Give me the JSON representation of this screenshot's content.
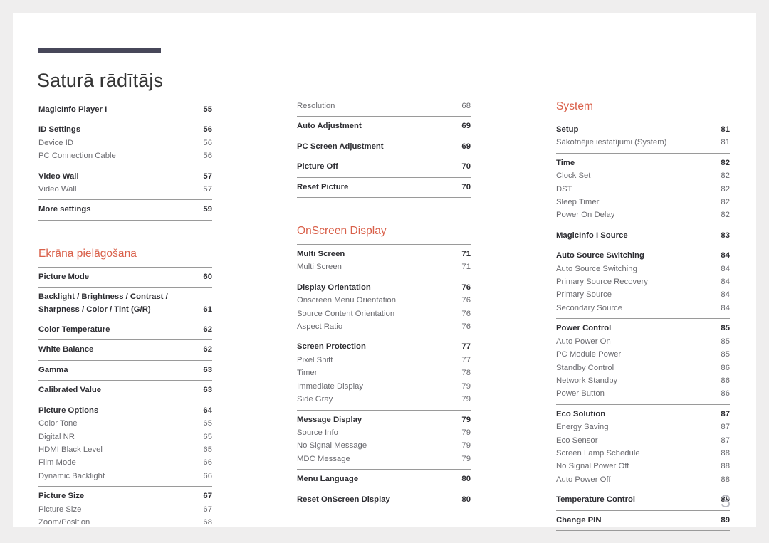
{
  "document": {
    "title": "Saturā rādītājs",
    "page_number": "3",
    "accent_color": "#d9604a",
    "rule_color": "#474759",
    "main_text_color": "#2e2e33",
    "sub_text_color": "#6a6a6f"
  },
  "columns": [
    {
      "id": "column-1",
      "blocks": [
        {
          "type": "groups",
          "groups": [
            {
              "entries": [
                {
                  "label": "MagicInfo Player I",
                  "page": "55",
                  "level": "main"
                }
              ]
            },
            {
              "entries": [
                {
                  "label": "ID Settings",
                  "page": "56",
                  "level": "main"
                },
                {
                  "label": "Device ID",
                  "page": "56",
                  "level": "sub"
                },
                {
                  "label": "PC Connection Cable",
                  "page": "56",
                  "level": "sub"
                }
              ]
            },
            {
              "entries": [
                {
                  "label": "Video Wall",
                  "page": "57",
                  "level": "main"
                },
                {
                  "label": "Video Wall",
                  "page": "57",
                  "level": "sub"
                }
              ]
            },
            {
              "last": true,
              "entries": [
                {
                  "label": "More settings",
                  "page": "59",
                  "level": "main"
                }
              ]
            }
          ]
        },
        {
          "type": "heading",
          "text": "Ekrāna pielāgošana",
          "gap": "large"
        },
        {
          "type": "groups",
          "groups": [
            {
              "entries": [
                {
                  "label": "Picture Mode",
                  "page": "60",
                  "level": "main"
                }
              ]
            },
            {
              "entries": [
                {
                  "label": "Backlight / Brightness / Contrast /\nSharpness / Color / Tint (G/R)",
                  "page": "61",
                  "level": "main",
                  "multiline": true
                }
              ]
            },
            {
              "entries": [
                {
                  "label": "Color Temperature",
                  "page": "62",
                  "level": "main"
                }
              ]
            },
            {
              "entries": [
                {
                  "label": "White Balance",
                  "page": "62",
                  "level": "main"
                }
              ]
            },
            {
              "entries": [
                {
                  "label": "Gamma",
                  "page": "63",
                  "level": "main"
                }
              ]
            },
            {
              "entries": [
                {
                  "label": "Calibrated Value",
                  "page": "63",
                  "level": "main"
                }
              ]
            },
            {
              "entries": [
                {
                  "label": "Picture Options",
                  "page": "64",
                  "level": "main"
                },
                {
                  "label": "Color Tone",
                  "page": "65",
                  "level": "sub"
                },
                {
                  "label": "Digital NR",
                  "page": "65",
                  "level": "sub"
                },
                {
                  "label": "HDMI Black Level",
                  "page": "65",
                  "level": "sub"
                },
                {
                  "label": "Film Mode",
                  "page": "66",
                  "level": "sub"
                },
                {
                  "label": "Dynamic Backlight",
                  "page": "66",
                  "level": "sub"
                }
              ]
            },
            {
              "entries": [
                {
                  "label": "Picture Size",
                  "page": "67",
                  "level": "main"
                },
                {
                  "label": "Picture Size",
                  "page": "67",
                  "level": "sub"
                },
                {
                  "label": "Zoom/Position",
                  "page": "68",
                  "level": "sub"
                }
              ]
            }
          ]
        }
      ]
    },
    {
      "id": "column-2",
      "blocks": [
        {
          "type": "groups",
          "groups": [
            {
              "entries": [
                {
                  "label": "Resolution",
                  "page": "68",
                  "level": "sub"
                }
              ]
            },
            {
              "entries": [
                {
                  "label": "Auto Adjustment",
                  "page": "69",
                  "level": "main"
                }
              ]
            },
            {
              "entries": [
                {
                  "label": "PC Screen Adjustment",
                  "page": "69",
                  "level": "main"
                }
              ]
            },
            {
              "entries": [
                {
                  "label": "Picture Off",
                  "page": "70",
                  "level": "main"
                }
              ]
            },
            {
              "last": true,
              "entries": [
                {
                  "label": "Reset Picture",
                  "page": "70",
                  "level": "main"
                }
              ]
            }
          ]
        },
        {
          "type": "heading",
          "text": "OnScreen Display",
          "gap": "large"
        },
        {
          "type": "groups",
          "groups": [
            {
              "entries": [
                {
                  "label": "Multi Screen",
                  "page": "71",
                  "level": "main"
                },
                {
                  "label": "Multi Screen",
                  "page": "71",
                  "level": "sub"
                }
              ]
            },
            {
              "entries": [
                {
                  "label": "Display Orientation",
                  "page": "76",
                  "level": "main"
                },
                {
                  "label": "Onscreen Menu Orientation",
                  "page": "76",
                  "level": "sub"
                },
                {
                  "label": "Source Content Orientation",
                  "page": "76",
                  "level": "sub"
                },
                {
                  "label": "Aspect Ratio",
                  "page": "76",
                  "level": "sub"
                }
              ]
            },
            {
              "entries": [
                {
                  "label": "Screen Protection",
                  "page": "77",
                  "level": "main"
                },
                {
                  "label": "Pixel Shift",
                  "page": "77",
                  "level": "sub"
                },
                {
                  "label": "Timer",
                  "page": "78",
                  "level": "sub"
                },
                {
                  "label": "Immediate Display",
                  "page": "79",
                  "level": "sub"
                },
                {
                  "label": "Side Gray",
                  "page": "79",
                  "level": "sub"
                }
              ]
            },
            {
              "entries": [
                {
                  "label": "Message Display",
                  "page": "79",
                  "level": "main"
                },
                {
                  "label": "Source Info",
                  "page": "79",
                  "level": "sub"
                },
                {
                  "label": "No Signal Message",
                  "page": "79",
                  "level": "sub"
                },
                {
                  "label": "MDC Message",
                  "page": "79",
                  "level": "sub"
                }
              ]
            },
            {
              "entries": [
                {
                  "label": "Menu Language",
                  "page": "80",
                  "level": "main"
                }
              ]
            },
            {
              "last": true,
              "entries": [
                {
                  "label": "Reset OnScreen Display",
                  "page": "80",
                  "level": "main"
                }
              ]
            }
          ]
        }
      ]
    },
    {
      "id": "column-3",
      "blocks": [
        {
          "type": "heading",
          "text": "System",
          "gap": "none"
        },
        {
          "type": "groups",
          "groups": [
            {
              "entries": [
                {
                  "label": "Setup",
                  "page": "81",
                  "level": "main"
                },
                {
                  "label": "Sākotnējie iestatījumi (System)",
                  "page": "81",
                  "level": "sub"
                }
              ]
            },
            {
              "entries": [
                {
                  "label": "Time",
                  "page": "82",
                  "level": "main"
                },
                {
                  "label": "Clock Set",
                  "page": "82",
                  "level": "sub"
                },
                {
                  "label": "DST",
                  "page": "82",
                  "level": "sub"
                },
                {
                  "label": "Sleep Timer",
                  "page": "82",
                  "level": "sub"
                },
                {
                  "label": "Power On Delay",
                  "page": "82",
                  "level": "sub"
                }
              ]
            },
            {
              "entries": [
                {
                  "label": "MagicInfo I Source",
                  "page": "83",
                  "level": "main"
                }
              ]
            },
            {
              "entries": [
                {
                  "label": "Auto Source Switching",
                  "page": "84",
                  "level": "main"
                },
                {
                  "label": "Auto Source Switching",
                  "page": "84",
                  "level": "sub"
                },
                {
                  "label": "Primary Source Recovery",
                  "page": "84",
                  "level": "sub"
                },
                {
                  "label": "Primary Source",
                  "page": "84",
                  "level": "sub"
                },
                {
                  "label": "Secondary Source",
                  "page": "84",
                  "level": "sub"
                }
              ]
            },
            {
              "entries": [
                {
                  "label": "Power Control",
                  "page": "85",
                  "level": "main"
                },
                {
                  "label": "Auto Power On",
                  "page": "85",
                  "level": "sub"
                },
                {
                  "label": "PC Module Power",
                  "page": "85",
                  "level": "sub"
                },
                {
                  "label": "Standby Control",
                  "page": "86",
                  "level": "sub"
                },
                {
                  "label": "Network Standby",
                  "page": "86",
                  "level": "sub"
                },
                {
                  "label": "Power Button",
                  "page": "86",
                  "level": "sub"
                }
              ]
            },
            {
              "entries": [
                {
                  "label": "Eco Solution",
                  "page": "87",
                  "level": "main"
                },
                {
                  "label": "Energy Saving",
                  "page": "87",
                  "level": "sub"
                },
                {
                  "label": "Eco Sensor",
                  "page": "87",
                  "level": "sub"
                },
                {
                  "label": "Screen Lamp Schedule",
                  "page": "88",
                  "level": "sub"
                },
                {
                  "label": "No Signal Power Off",
                  "page": "88",
                  "level": "sub"
                },
                {
                  "label": "Auto Power Off",
                  "page": "88",
                  "level": "sub"
                }
              ]
            },
            {
              "entries": [
                {
                  "label": "Temperature Control",
                  "page": "89",
                  "level": "main"
                }
              ]
            },
            {
              "last": true,
              "entries": [
                {
                  "label": "Change PIN",
                  "page": "89",
                  "level": "main"
                }
              ]
            }
          ]
        }
      ]
    }
  ]
}
